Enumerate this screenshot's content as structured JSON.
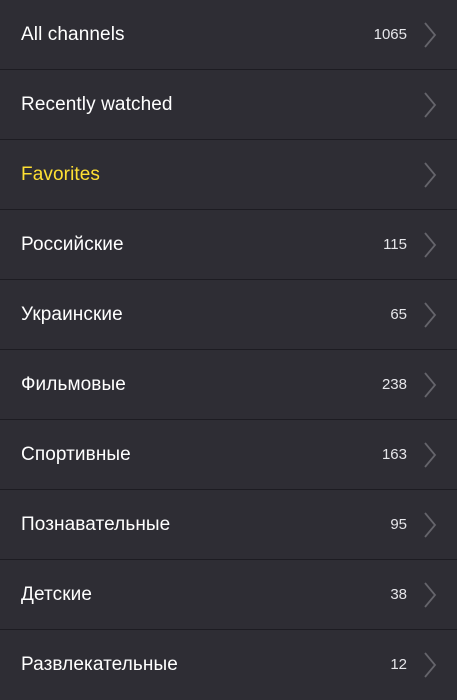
{
  "colors": {
    "background": "#2e2d34",
    "divider": "#1d1c22",
    "text": "#ffffff",
    "highlight": "#ffe033",
    "chevron": "#65646b"
  },
  "items": [
    {
      "label": "All channels",
      "count": "1065",
      "highlighted": false,
      "icon": "chevron-right-icon"
    },
    {
      "label": "Recently watched",
      "count": "",
      "highlighted": false,
      "icon": "chevron-right-icon"
    },
    {
      "label": "Favorites",
      "count": "",
      "highlighted": true,
      "icon": "chevron-right-icon"
    },
    {
      "label": "Российские",
      "count": "115",
      "highlighted": false,
      "icon": "chevron-right-icon"
    },
    {
      "label": "Украинские",
      "count": "65",
      "highlighted": false,
      "icon": "chevron-right-icon"
    },
    {
      "label": "Фильмовые",
      "count": "238",
      "highlighted": false,
      "icon": "chevron-right-icon"
    },
    {
      "label": "Спортивные",
      "count": "163",
      "highlighted": false,
      "icon": "chevron-right-icon"
    },
    {
      "label": "Познавательные",
      "count": "95",
      "highlighted": false,
      "icon": "chevron-right-icon"
    },
    {
      "label": "Детские",
      "count": "38",
      "highlighted": false,
      "icon": "chevron-right-icon"
    },
    {
      "label": "Развлекательные",
      "count": "12",
      "highlighted": false,
      "icon": "chevron-right-icon"
    }
  ]
}
